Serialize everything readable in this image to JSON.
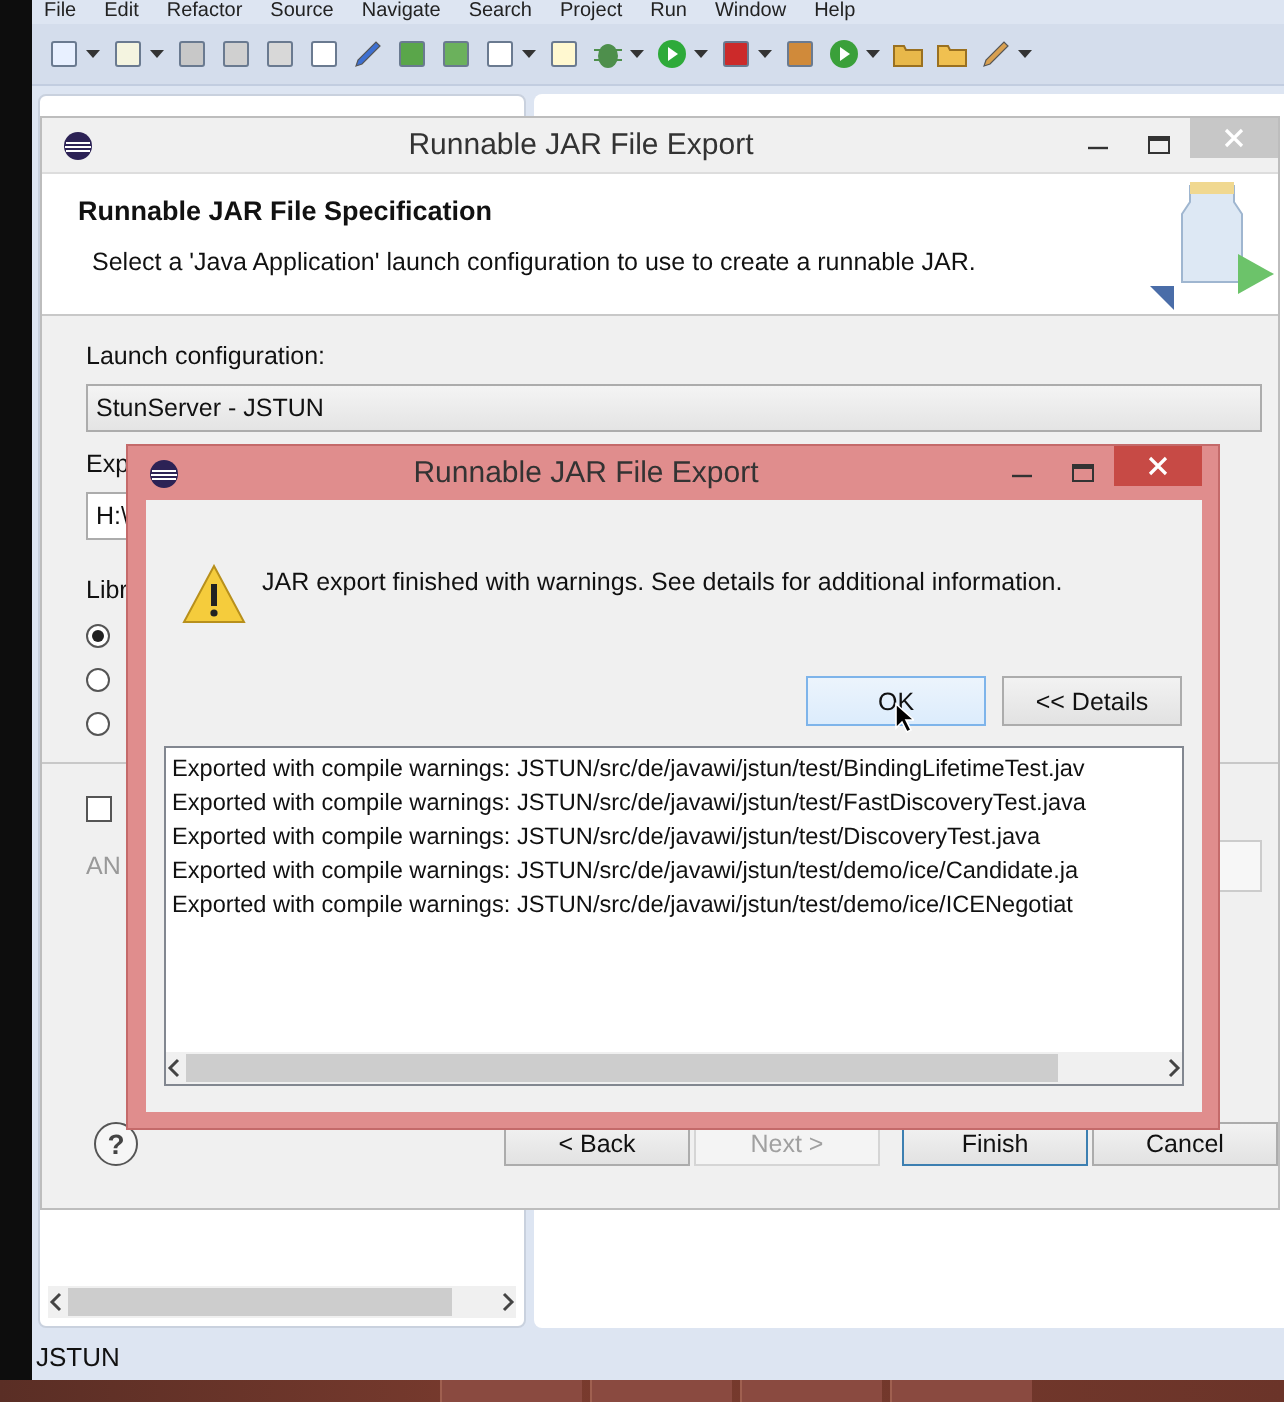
{
  "menu_bar": [
    "File",
    "Edit",
    "Refactor",
    "Source",
    "Navigate",
    "Search",
    "Project",
    "Run",
    "Window",
    "Help"
  ],
  "wizard": {
    "title": "Runnable JAR File Export",
    "heading": "Runnable JAR File Specification",
    "description": "Select a 'Java Application' launch configuration to use to create a runnable JAR.",
    "launch_label": "Launch configuration:",
    "launch_value": "StunServer - JSTUN",
    "export_label": "Exp",
    "export_value": "H:\\",
    "library_label": "Libr",
    "library_options": [
      {
        "selected": true
      },
      {
        "selected": false
      },
      {
        "selected": false
      }
    ],
    "save_option": {
      "checked": false
    },
    "ant_label": "AN",
    "help_button": "?",
    "buttons": [
      {
        "label": "< Back",
        "disabled": false,
        "default": false
      },
      {
        "label": "Next >",
        "disabled": true,
        "default": false
      },
      {
        "label": "Finish",
        "disabled": false,
        "default": true
      },
      {
        "label": "Cancel",
        "disabled": false,
        "default": false
      }
    ]
  },
  "message_dialog": {
    "title": "Runnable JAR File Export",
    "message": "JAR export finished with warnings. See details for additional information.",
    "buttons": [
      {
        "label": "OK",
        "default": true
      },
      {
        "label": "<< Details",
        "default": false
      }
    ],
    "details": [
      "Exported with compile warnings: JSTUN/src/de/javawi/jstun/test/BindingLifetimeTest.jav",
      "Exported with compile warnings: JSTUN/src/de/javawi/jstun/test/FastDiscoveryTest.java",
      "Exported with compile warnings: JSTUN/src/de/javawi/jstun/test/DiscoveryTest.java",
      "Exported with compile warnings: JSTUN/src/de/javawi/jstun/test/demo/ice/Candidate.ja",
      "Exported with compile warnings: JSTUN/src/de/javawi/jstun/test/demo/ice/ICENegotiat"
    ]
  },
  "status_bar": {
    "text": "JSTUN"
  }
}
